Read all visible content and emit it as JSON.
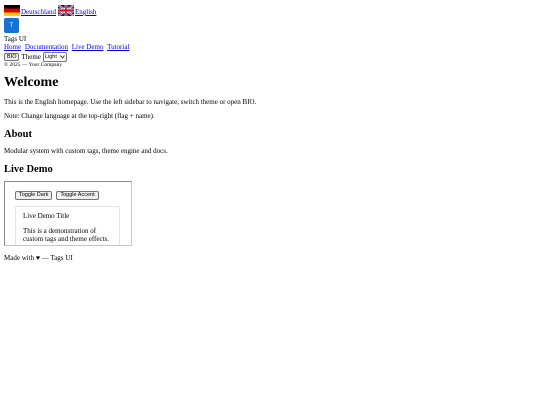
{
  "lang": {
    "de_label": "Deutschland",
    "en_label": "English"
  },
  "logo": {
    "letter": "T"
  },
  "header": {
    "brand": "Tags UI",
    "nav": [
      "Home",
      "Documentation",
      "Live Demo",
      "Tutorial"
    ],
    "bio_button": "BIO",
    "theme_label": "Theme",
    "theme_value": "Light",
    "copyright": "© 2025 — Your Company"
  },
  "main": {
    "title": "Welcome",
    "intro": "This is the English homepage. Use the left sidebar to navigate, switch theme or open BIO.",
    "note": "Note: Change language at the top-right (flag + name).",
    "about_heading": "About",
    "about_text": "Modular system with custom tags, theme engine and docs.",
    "demo_heading": "Live Demo"
  },
  "demo": {
    "toggle_dark": "Toggle Dark",
    "toggle_accent": "Toggle Accent",
    "card_title": "Live Demo Title",
    "card_text": "This is a demonstration of custom tags and theme effects."
  },
  "footer": {
    "text": "Made with ♥ — Tags UI"
  },
  "colors": {
    "logo_bg": "#1672d6",
    "link": "#0000ee"
  }
}
